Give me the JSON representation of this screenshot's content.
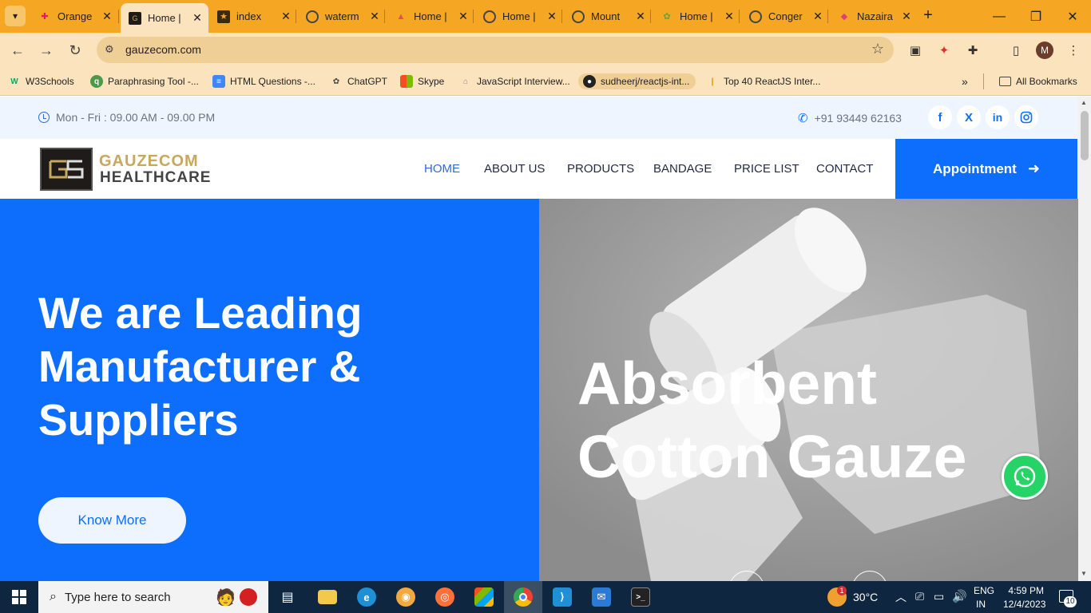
{
  "browser": {
    "tabs": [
      {
        "label": "Orange",
        "icon": "slack-like-icon",
        "active": false
      },
      {
        "label": "Home |",
        "icon": "gauzecom-favicon",
        "active": true
      },
      {
        "label": "index",
        "icon": "star-favicon",
        "active": false
      },
      {
        "label": "waterm",
        "icon": "globe-icon",
        "active": false
      },
      {
        "label": "Home |",
        "icon": "tent-favicon",
        "active": false
      },
      {
        "label": "Home |",
        "icon": "globe-icon",
        "active": false
      },
      {
        "label": "Mount",
        "icon": "globe-icon",
        "active": false
      },
      {
        "label": "Home |",
        "icon": "leaf-favicon",
        "active": false
      },
      {
        "label": "Conger",
        "icon": "globe-icon",
        "active": false
      },
      {
        "label": "Nazaira",
        "icon": "diamond-favicon",
        "active": false
      }
    ],
    "url": "gauzecom.com",
    "profile_initial": "M",
    "bookmarks": [
      {
        "label": "W3Schools",
        "icon": "w3schools-icon"
      },
      {
        "label": "Paraphrasing Tool -...",
        "icon": "quillbot-icon"
      },
      {
        "label": "HTML Questions -...",
        "icon": "docs-icon"
      },
      {
        "label": "ChatGPT",
        "icon": "chatgpt-icon"
      },
      {
        "label": "Skype",
        "icon": "microsoft-icon"
      },
      {
        "label": "JavaScript Interview...",
        "icon": "js-icon"
      },
      {
        "label": "sudheerj/reactjs-int...",
        "icon": "github-icon"
      },
      {
        "label": "Top 40 ReactJS Inter...",
        "icon": "bookmark-icon"
      }
    ],
    "all_bookmarks": "All Bookmarks"
  },
  "site": {
    "hours": "Mon - Fri : 09.00 AM - 09.00 PM",
    "phone": "+91 93449 62163",
    "social": [
      "f",
      "X",
      "in",
      "ig"
    ],
    "logo_line1": "GAUZECOM",
    "logo_line2": "HEALTHCARE",
    "menu": [
      "HOME",
      "ABOUT US",
      "PRODUCTS",
      "BANDAGE",
      "PRICE LIST",
      "CONTACT"
    ],
    "appointment": "Appointment",
    "hero_title": "We are Leading Manufacturer & Suppliers",
    "hero_button": "Know More",
    "slide_caption_line1": "Absorbent",
    "slide_caption_line2": "Cotton Gauze",
    "colors": {
      "primary": "#0d6efd",
      "topbar": "#eef5ff",
      "logo_gold": "#c7a85d",
      "whatsapp": "#25d366"
    }
  },
  "taskbar": {
    "search_placeholder": "Type here to search",
    "weather": "30°C",
    "weather_badge": "1",
    "lang_line1": "ENG",
    "lang_line2": "IN",
    "time": "4:59 PM",
    "date": "12/4/2023",
    "notifications": "10"
  }
}
